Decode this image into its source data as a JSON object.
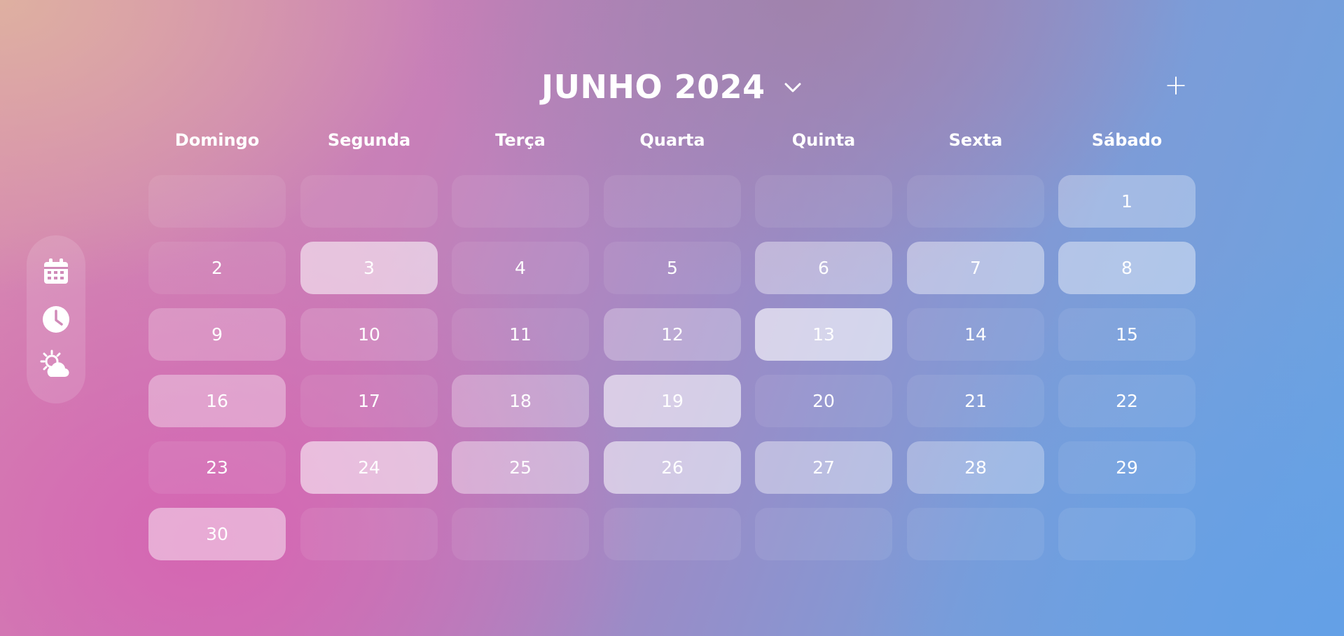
{
  "header": {
    "title": "JUNHO 2024",
    "add_label": "+"
  },
  "weekdays": [
    "Domingo",
    "Segunda",
    "Terça",
    "Quarta",
    "Quinta",
    "Sexta",
    "Sábado"
  ],
  "days": [
    {
      "label": "",
      "alpha": 0.08
    },
    {
      "label": "",
      "alpha": 0.08
    },
    {
      "label": "",
      "alpha": 0.08
    },
    {
      "label": "",
      "alpha": 0.08
    },
    {
      "label": "",
      "alpha": 0.08
    },
    {
      "label": "",
      "alpha": 0.08
    },
    {
      "label": "1",
      "alpha": 0.3
    },
    {
      "label": "2",
      "alpha": 0.08
    },
    {
      "label": "3",
      "alpha": 0.55
    },
    {
      "label": "4",
      "alpha": 0.08
    },
    {
      "label": "5",
      "alpha": 0.08
    },
    {
      "label": "6",
      "alpha": 0.38
    },
    {
      "label": "7",
      "alpha": 0.42
    },
    {
      "label": "8",
      "alpha": 0.42
    },
    {
      "label": "9",
      "alpha": 0.22
    },
    {
      "label": "10",
      "alpha": 0.15
    },
    {
      "label": "11",
      "alpha": 0.08
    },
    {
      "label": "12",
      "alpha": 0.28
    },
    {
      "label": "13",
      "alpha": 0.62
    },
    {
      "label": "14",
      "alpha": 0.08
    },
    {
      "label": "15",
      "alpha": 0.08
    },
    {
      "label": "16",
      "alpha": 0.35
    },
    {
      "label": "17",
      "alpha": 0.08
    },
    {
      "label": "18",
      "alpha": 0.28
    },
    {
      "label": "19",
      "alpha": 0.58
    },
    {
      "label": "20",
      "alpha": 0.08
    },
    {
      "label": "21",
      "alpha": 0.08
    },
    {
      "label": "22",
      "alpha": 0.08
    },
    {
      "label": "23",
      "alpha": 0.08
    },
    {
      "label": "24",
      "alpha": 0.55
    },
    {
      "label": "25",
      "alpha": 0.4
    },
    {
      "label": "26",
      "alpha": 0.55
    },
    {
      "label": "27",
      "alpha": 0.4
    },
    {
      "label": "28",
      "alpha": 0.3
    },
    {
      "label": "29",
      "alpha": 0.08
    },
    {
      "label": "30",
      "alpha": 0.45
    },
    {
      "label": "",
      "alpha": 0.08
    },
    {
      "label": "",
      "alpha": 0.08
    },
    {
      "label": "",
      "alpha": 0.08
    },
    {
      "label": "",
      "alpha": 0.08
    },
    {
      "label": "",
      "alpha": 0.08
    },
    {
      "label": "",
      "alpha": 0.08
    }
  ],
  "sidebar": {
    "icons": [
      "calendar-icon",
      "clock-icon",
      "weather-icon"
    ]
  },
  "colors": {
    "text": "#ffffff",
    "cell_base": "#ffffff"
  }
}
